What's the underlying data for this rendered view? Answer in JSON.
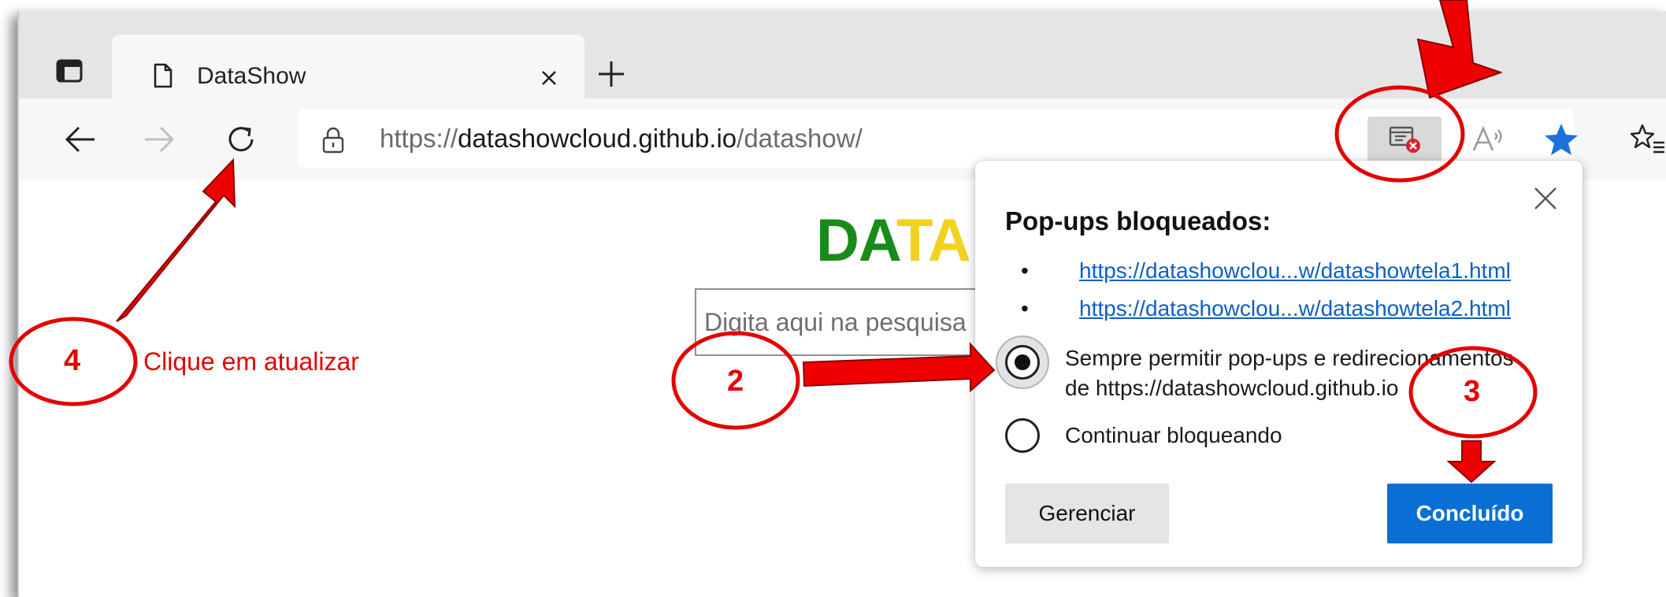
{
  "browser": {
    "tab": {
      "title": "DataShow"
    },
    "address": {
      "scheme": "https://",
      "host": "datashowcloud.github.io",
      "path": "/datashow/"
    }
  },
  "page": {
    "logo": {
      "part1": "DA",
      "part2": "TA"
    },
    "search": {
      "placeholder": "Digita aqui na pesquisa"
    }
  },
  "popup": {
    "title": "Pop-ups bloqueados:",
    "links": [
      "https://datashowclou...w/datashowtela1.html",
      "https://datashowclou...w/datashowtela2.html"
    ],
    "options": [
      {
        "line1": "Sempre permitir pop-ups e redirecionamentos",
        "line2": "de https://datashowcloud.github.io",
        "selected": true
      },
      {
        "line1": "Continuar bloqueando",
        "selected": false
      }
    ],
    "manage_label": "Gerenciar",
    "done_label": "Concluído"
  },
  "annotations": {
    "step2": "2",
    "step3": "3",
    "step4": "4",
    "step4_text": "Clique em atualizar",
    "color": "#e30000"
  },
  "colors": {
    "accent": "#0a6fd4",
    "link": "#0f5fc2",
    "favorite_star": "#1a73d9",
    "logo_green": "#1a8a1a",
    "logo_yellow": "#f2d21b"
  }
}
